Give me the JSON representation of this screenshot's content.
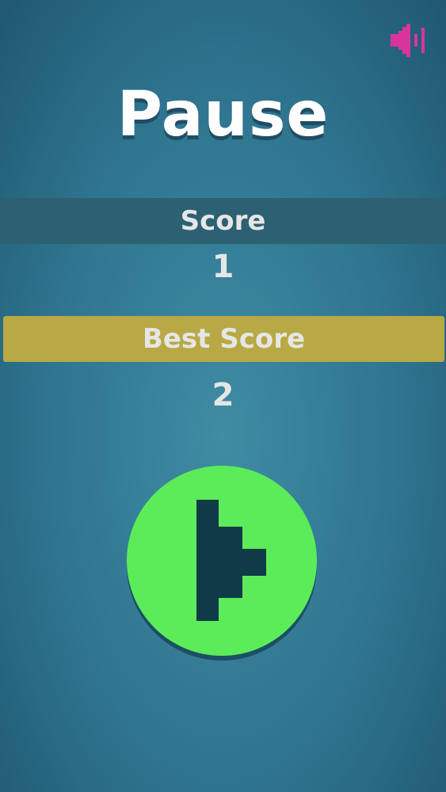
{
  "screen": {
    "title": "Pause",
    "score_label": "Score",
    "score_value": "1",
    "best_label": "Best Score",
    "best_value": "2"
  },
  "icons": {
    "sound": "speaker-icon",
    "play": "play-icon"
  },
  "colors": {
    "sound_icon": "#d8349b",
    "play_button": "#5cec5a",
    "play_glyph": "#0f3a47",
    "best_band": "#b8a944",
    "score_band": "#2c6174"
  }
}
